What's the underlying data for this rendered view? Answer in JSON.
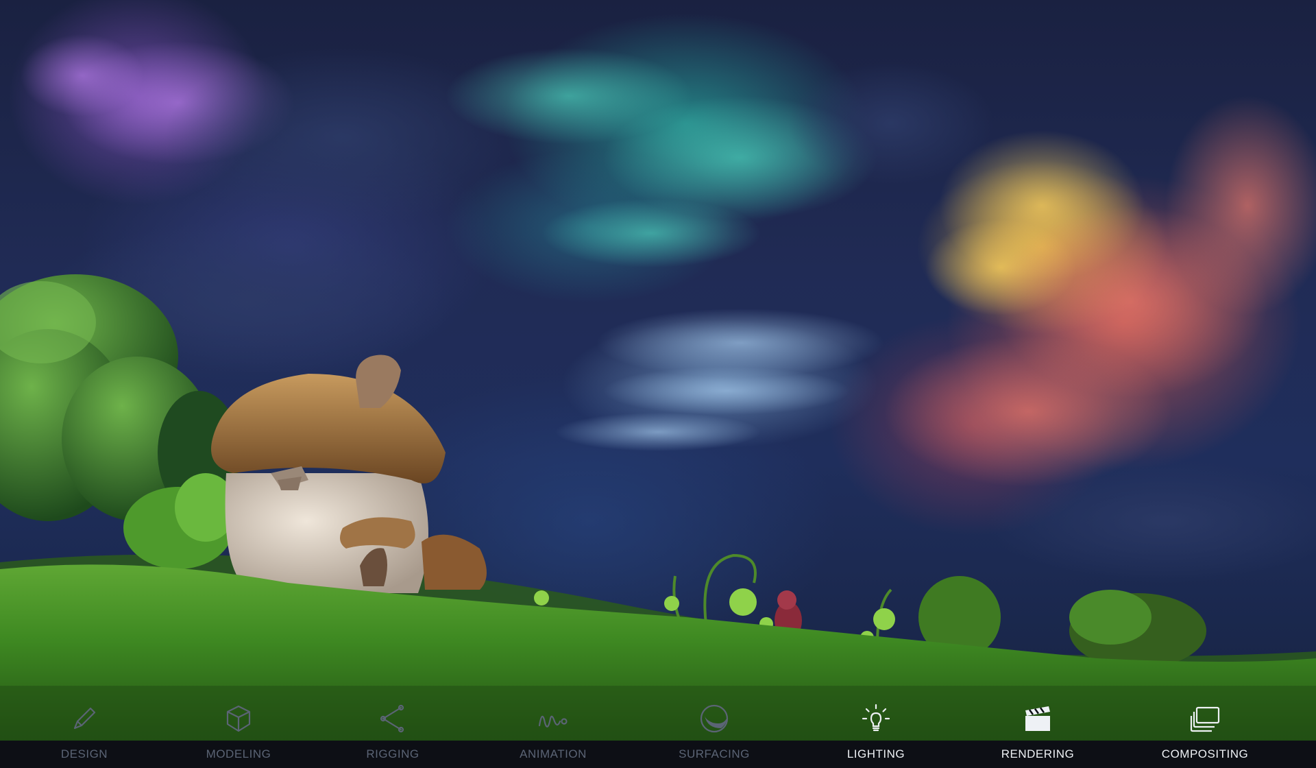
{
  "nav": {
    "items": [
      {
        "key": "design",
        "label": "DESIGN",
        "icon": "pencil-icon",
        "active": false
      },
      {
        "key": "modeling",
        "label": "MODELING",
        "icon": "cube-icon",
        "active": false
      },
      {
        "key": "rigging",
        "label": "RIGGING",
        "icon": "rigging-joint-icon",
        "active": false
      },
      {
        "key": "animation",
        "label": "ANIMATION",
        "icon": "animation-curve-icon",
        "active": false
      },
      {
        "key": "surfacing",
        "label": "SURFACING",
        "icon": "sphere-icon",
        "active": false
      },
      {
        "key": "lighting",
        "label": "LIGHTING",
        "icon": "lightbulb-icon",
        "active": true
      },
      {
        "key": "rendering",
        "label": "RENDERING",
        "icon": "clapperboard-icon",
        "active": true
      },
      {
        "key": "compositing",
        "label": "COMPOSITING",
        "icon": "stacked-layers-icon",
        "active": true
      }
    ]
  },
  "colors": {
    "inactive_text": "#5b6475",
    "active_text": "#eef1f5",
    "bar_background": "#0d0f15"
  }
}
